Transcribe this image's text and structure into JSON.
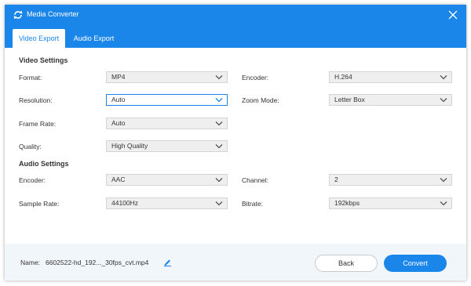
{
  "window": {
    "title": "Media Converter",
    "accent_color": "#1a86ea"
  },
  "tabs": [
    {
      "label": "Video Export",
      "active": true
    },
    {
      "label": "Audio Export",
      "active": false
    }
  ],
  "video_settings": {
    "heading": "Video Settings",
    "format": {
      "label": "Format:",
      "value": "MP4"
    },
    "encoder": {
      "label": "Encoder:",
      "value": "H.264"
    },
    "resolution": {
      "label": "Resolution:",
      "value": "Auto"
    },
    "zoom_mode": {
      "label": "Zoom Mode:",
      "value": "Letter Box"
    },
    "frame_rate": {
      "label": "Frame Rate:",
      "value": "Auto"
    },
    "quality": {
      "label": "Quality:",
      "value": "High Quality"
    }
  },
  "audio_settings": {
    "heading": "Audio Settings",
    "encoder": {
      "label": "Encoder:",
      "value": "AAC"
    },
    "channel": {
      "label": "Channel:",
      "value": "2"
    },
    "sample_rate": {
      "label": "Sample Rate:",
      "value": "44100Hz"
    },
    "bitrate": {
      "label": "Bitrate:",
      "value": "192kbps"
    }
  },
  "footer": {
    "name_label": "Name:",
    "name_value": "6602522-hd_192..._30fps_cvt.mp4",
    "back_label": "Back",
    "convert_label": "Convert"
  },
  "icons": {
    "app": "refresh-icon",
    "close": "close-icon",
    "dropdown": "chevron-down-icon",
    "edit": "pencil-icon"
  }
}
